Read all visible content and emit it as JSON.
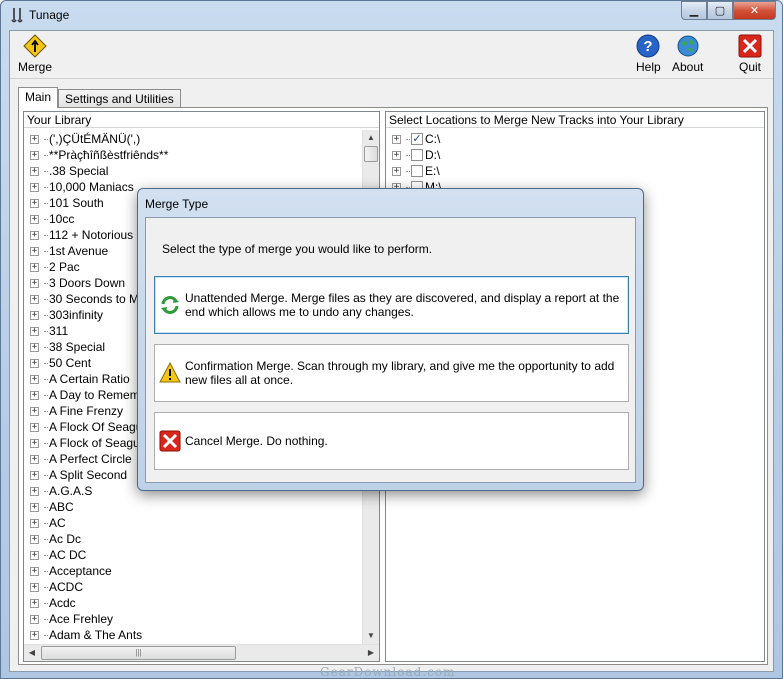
{
  "window": {
    "title": "Tunage"
  },
  "toolbar": {
    "merge_label": "Merge",
    "help_label": "Help",
    "about_label": "About",
    "quit_label": "Quit"
  },
  "tabs": [
    {
      "label": "Main",
      "active": true
    },
    {
      "label": "Settings and Utilities",
      "active": false
    }
  ],
  "library": {
    "header": "Your Library",
    "items": [
      "(',)ÇÜtÉMÄNÜ(',)",
      "**Pràçħîñßèstfriênds**",
      ".38 Special",
      "10,000 Maniacs",
      "101 South",
      "10cc",
      "112 + Notorious BIG",
      "1st Avenue",
      "2 Pac",
      "3 Doors Down",
      "30 Seconds to Mars",
      "303infinity",
      "311",
      "38 Special",
      "50 Cent",
      "A Certain Ratio",
      "A Day to Remember",
      "A Fine Frenzy",
      "A Flock Of Seagulls",
      "A Flock of Seagulls",
      "A Perfect Circle",
      "A Split Second",
      "A.G.A.S",
      "ABC",
      "AC",
      "Ac Dc",
      "AC DC",
      "Acceptance",
      "ACDC",
      "Acdc",
      "Ace Frehley",
      "Adam & The Ants"
    ]
  },
  "locations": {
    "header": "Select Locations to Merge New Tracks into Your Library",
    "items": [
      {
        "label": "C:\\",
        "checked": true
      },
      {
        "label": "D:\\",
        "checked": false
      },
      {
        "label": "E:\\",
        "checked": false
      },
      {
        "label": "M:\\",
        "checked": false
      }
    ]
  },
  "dialog": {
    "title": "Merge Type",
    "prompt": "Select the type of merge you would like to perform.",
    "options": [
      {
        "icon": "refresh-icon",
        "text": "Unattended Merge.  Merge files as they are discovered, and display a report at the end which allows me to undo any changes.",
        "selected": true
      },
      {
        "icon": "warning-icon",
        "text": "Confirmation Merge.  Scan through my library, and give me the opportunity to add new files all at once.",
        "selected": false
      },
      {
        "icon": "cancel-icon",
        "text": "Cancel Merge.  Do nothing.",
        "selected": false
      }
    ]
  },
  "watermark": "GearDownload.com",
  "colors": {
    "selected_border": "#3c7fb1",
    "cancel_red": "#d9261c",
    "warning_yellow": "#f5c518",
    "refresh_green": "#2e9a3a"
  }
}
